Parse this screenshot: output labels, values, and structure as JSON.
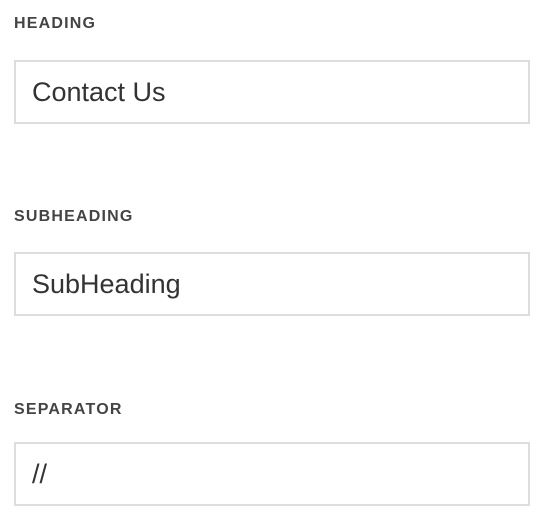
{
  "fields": {
    "heading": {
      "label": "HEADING",
      "value": "Contact Us"
    },
    "subheading": {
      "label": "SUBHEADING",
      "value": "SubHeading"
    },
    "separator": {
      "label": "SEPARATOR",
      "value": "//"
    }
  }
}
